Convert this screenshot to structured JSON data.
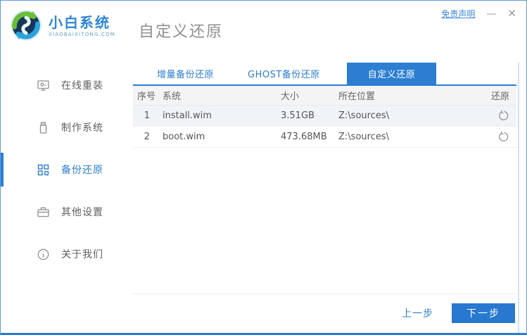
{
  "header": {
    "logo": {
      "brand": "小白系统",
      "domain": "XIAOBAIXITONG.COM"
    },
    "title": "自定义还原",
    "disclaimer": "免责声明",
    "minimize": "—",
    "close": "✕"
  },
  "sidebar": {
    "items": [
      {
        "label": "在线重装",
        "icon": "monitor-icon",
        "active": false
      },
      {
        "label": "制作系统",
        "icon": "usb-drive-icon",
        "active": false
      },
      {
        "label": "备份还原",
        "icon": "grid-icon",
        "active": true
      },
      {
        "label": "其他设置",
        "icon": "toolbox-icon",
        "active": false
      },
      {
        "label": "关于我们",
        "icon": "info-icon",
        "active": false
      }
    ]
  },
  "main": {
    "tabs": [
      {
        "label": "增量备份还原",
        "active": false
      },
      {
        "label": "GHOST备份还原",
        "active": false
      },
      {
        "label": "自定义还原",
        "active": true
      }
    ],
    "table": {
      "headers": [
        "序号",
        "系统",
        "大小",
        "所在位置",
        "还原"
      ],
      "rows": [
        {
          "index": "1",
          "system": "install.wim",
          "size": "3.51GB",
          "location": "Z:\\sources\\",
          "action_icon": "restore-icon"
        },
        {
          "index": "2",
          "system": "boot.wim",
          "size": "473.68MB",
          "location": "Z:\\sources\\",
          "action_icon": "restore-icon"
        }
      ]
    },
    "footer": {
      "prev_label": "上一步",
      "next_label": "下一步"
    }
  },
  "colors": {
    "accent_blue": "#2b7ed2",
    "button_blue": "#2878cf",
    "window_border": "#5e9bdc",
    "title_gray": "#8f8f8f",
    "row_alt_bg": "#f0f3f7",
    "logo_green": "#6abf3a",
    "logo_cyan": "#2aa3dc"
  }
}
